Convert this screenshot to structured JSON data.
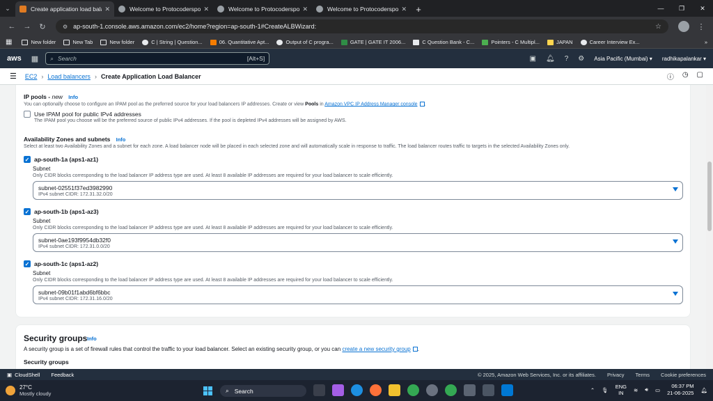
{
  "browser": {
    "tabs": [
      {
        "title": "Create application load balanc",
        "active": true
      },
      {
        "title": "Welcome to Protocoderspoint",
        "active": false
      },
      {
        "title": "Welcome to Protocoderspoint",
        "active": false
      },
      {
        "title": "Welcome to Protocoderspoint",
        "active": false
      }
    ],
    "url": "ap-south-1.console.aws.amazon.com/ec2/home?region=ap-south-1#CreateALBWizard:",
    "bookmarks": [
      "New folder",
      "New Tab",
      "New folder",
      "C | String | Question...",
      "06. Quantitative Apt...",
      "Output of C progra...",
      "GATE | GATE IT 2006...",
      "C Question Bank - C...",
      "Pointers - C Multipl...",
      "JAPAN",
      "Career Interview Ex..."
    ]
  },
  "aws": {
    "logo": "aws",
    "search_placeholder": "Search",
    "search_shortcut": "[Alt+S]",
    "region": "Asia Pacific (Mumbai) ▾",
    "user": "radhikapalankar ▾"
  },
  "breadcrumb": {
    "ec2": "EC2",
    "load_balancers": "Load balancers",
    "current": "Create Application Load Balancer"
  },
  "ip_pools": {
    "title": "IP pools",
    "title_suffix": "new",
    "info": "Info",
    "desc_prefix": "You can optionally choose to configure an IPAM pool as the preferred source for your load balancers IP addresses. Create or view",
    "desc_pools": "Pools",
    "desc_mid": "in",
    "desc_link": "Amazon VPC IP Address Manager console",
    "checkbox_label": "Use IPAM pool for public IPv4 addresses",
    "checkbox_desc": "The IPAM pool you choose will be the preferred source of public IPv4 addresses. If the pool is depleted IPv4 addresses will be assigned by AWS."
  },
  "az": {
    "title": "Availability Zones and subnets",
    "info": "Info",
    "desc": "Select at least two Availability Zones and a subnet for each zone. A load balancer node will be placed in each selected zone and will automatically scale in response to traffic. The load balancer routes traffic to targets in the selected Availability Zones only.",
    "subnet_label": "Subnet",
    "subnet_desc": "Only CIDR blocks corresponding to the load balancer IP address type are used. At least 8 available IP addresses are required for your load balancer to scale efficiently.",
    "zones": [
      {
        "name": "ap-south-1a (aps1-az1)",
        "subnet": "subnet-02551f37ed3982990",
        "cidr": "IPv4 subnet CIDR: 172.31.32.0/20"
      },
      {
        "name": "ap-south-1b (aps1-az3)",
        "subnet": "subnet-0ae193f9954db32f0",
        "cidr": "IPv4 subnet CIDR: 172.31.0.0/20"
      },
      {
        "name": "ap-south-1c (aps1-az2)",
        "subnet": "subnet-09b01f1abd6bf6bbc",
        "cidr": "IPv4 subnet CIDR: 172.31.16.0/20"
      }
    ]
  },
  "security_groups": {
    "title": "Security groups",
    "info": "Info",
    "desc_prefix": "A security group is a set of firewall rules that control the traffic to your load balancer. Select an existing security group, or you can",
    "desc_link": "create a new security group",
    "sub_label": "Security groups"
  },
  "footer": {
    "cloudshell": "CloudShell",
    "feedback": "Feedback",
    "copyright": "© 2025, Amazon Web Services, Inc. or its affiliates.",
    "privacy": "Privacy",
    "terms": "Terms",
    "cookie": "Cookie preferences"
  },
  "taskbar": {
    "temp": "27°C",
    "weather": "Mostly cloudy",
    "search": "Search",
    "lang1": "ENG",
    "lang2": "IN",
    "time": "06:37 PM",
    "date": "21-06-2025"
  },
  "colors": {
    "aws_nav": "#232f3e",
    "link": "#0972d3",
    "checkbox": "#0972d3"
  }
}
